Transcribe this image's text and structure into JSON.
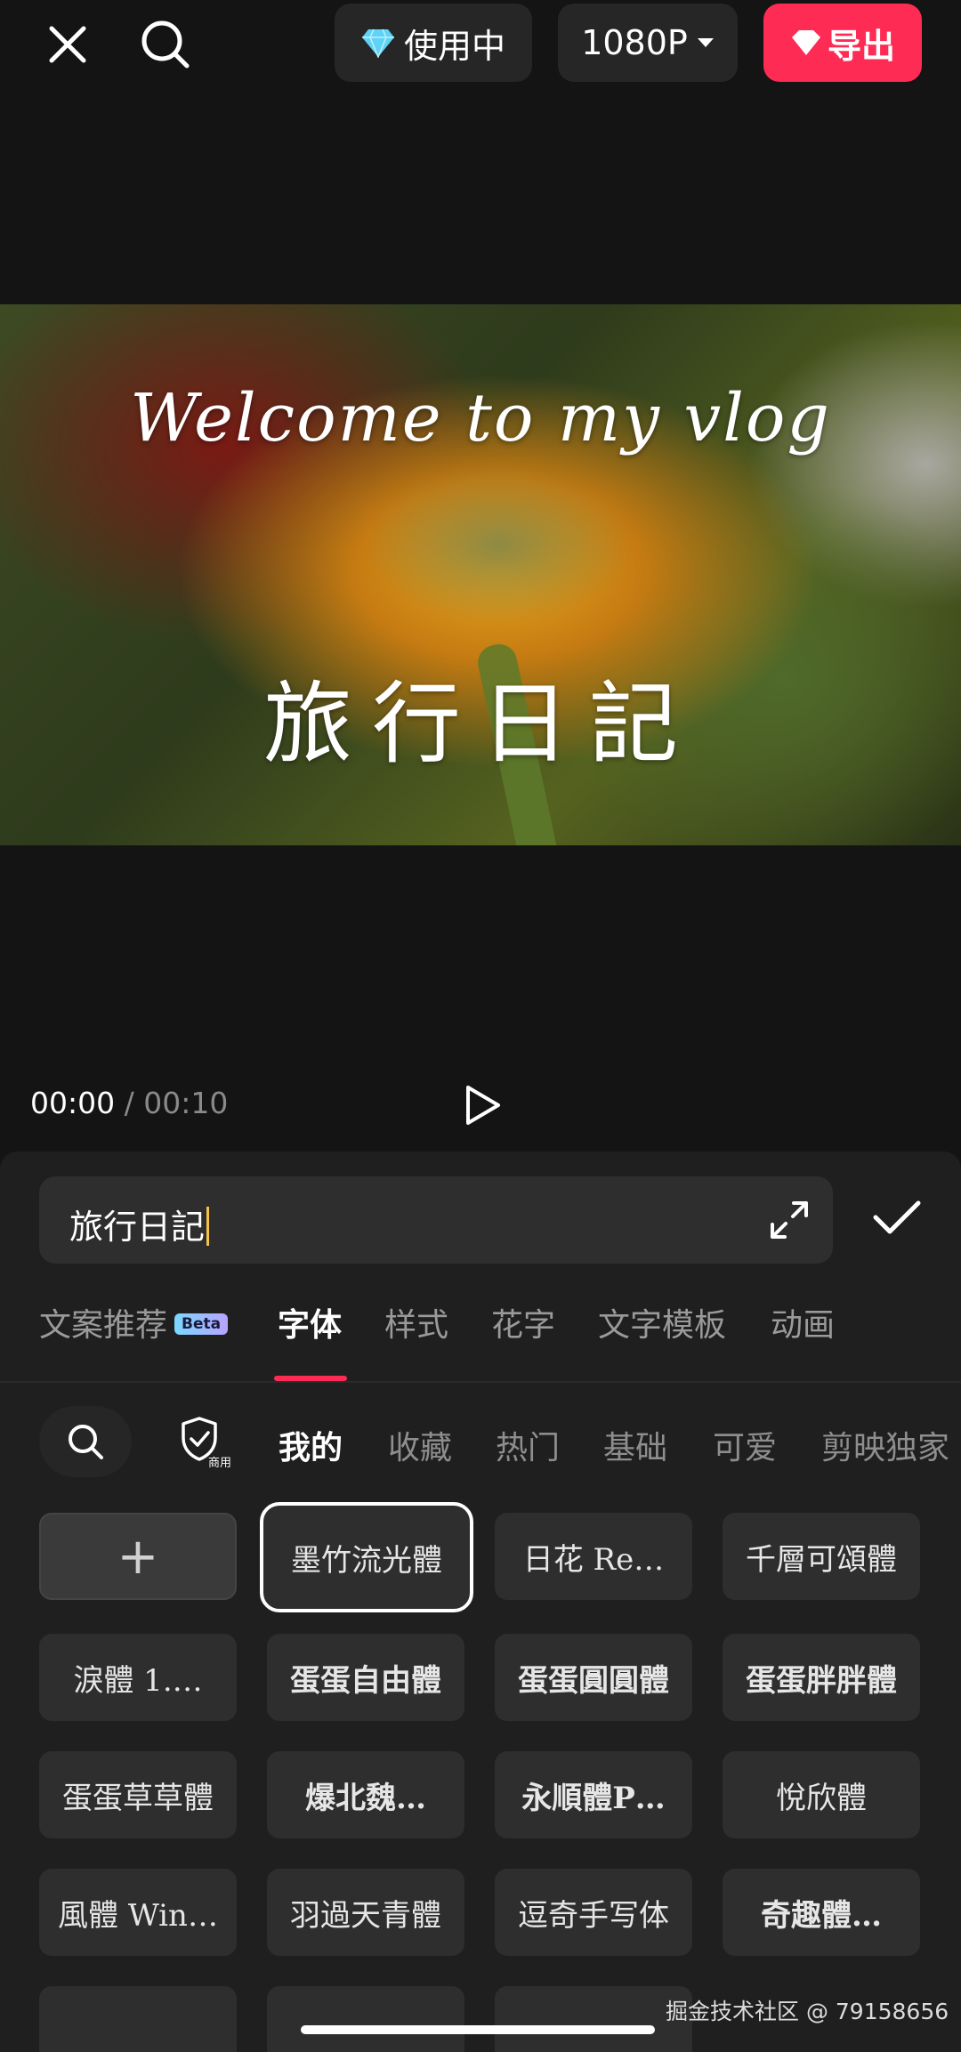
{
  "topbar": {
    "vip_label": "使用中",
    "resolution": "1080P",
    "export_label": "导出"
  },
  "preview": {
    "line1": "Welcome to my vlog",
    "line2": "旅行日記"
  },
  "playback": {
    "current": "00:00",
    "separator": "/",
    "duration": "00:10"
  },
  "editor": {
    "text_value": "旅行日記"
  },
  "tabs": [
    {
      "label": "文案推荐",
      "badge": "Beta"
    },
    {
      "label": "字体"
    },
    {
      "label": "样式"
    },
    {
      "label": "花字"
    },
    {
      "label": "文字模板"
    },
    {
      "label": "动画"
    }
  ],
  "font_tabs": {
    "commercial_label": "商用",
    "items": [
      "我的",
      "收藏",
      "热门",
      "基础",
      "可爱",
      "剪映独家"
    ]
  },
  "fonts": [
    "+",
    "墨竹流光體",
    "日花 Re…",
    "千層可頌體",
    "淚體 1.…",
    "蛋蛋自由體",
    "蛋蛋圓圓體",
    "蛋蛋胖胖體",
    "蛋蛋草草體",
    "爆北魏…",
    "永順體P…",
    "悅欣體",
    "風體 Win…",
    "羽過天青體",
    "逗奇手写体",
    "奇趣體…"
  ],
  "watermark": "掘金技术社区 @ 79158656",
  "colors": {
    "accent": "#fe2c55",
    "background": "#141414",
    "panel": "#1f1f1f",
    "cell": "#2e2e2e",
    "caret": "#f6c244"
  }
}
